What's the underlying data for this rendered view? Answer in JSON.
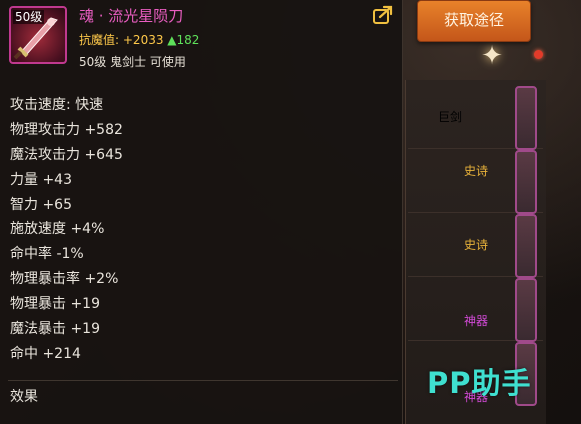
{
  "item": {
    "level_badge": "50级",
    "name": "魂 · 流光星陨刀",
    "resist_label": "抗魔值:",
    "resist_value": "+2033",
    "resist_diff": "▲182",
    "requirement": "50级 鬼剑士 可使用",
    "icon": "sword-icon",
    "name_color": "#e85dc0"
  },
  "stats": [
    "攻击速度: 快速",
    "物理攻击力 +582",
    "魔法攻击力 +645",
    "力量 +43",
    "智力 +65",
    "施放速度 +4%",
    "命中率 -1%",
    "物理暴击率 +2%",
    "物理暴击 +19",
    "魔法暴击 +19",
    "命中 +214"
  ],
  "effect_label": "效果",
  "get_button": {
    "label": "获取途径"
  },
  "share_icon": "share-icon",
  "right_panel": {
    "rows": [
      {
        "label": "巨剑",
        "color": "#b9a98a"
      },
      {
        "label": "史诗",
        "color": "#e8b23a"
      },
      {
        "label": "史诗",
        "color": "#e8b23a"
      },
      {
        "label": "神器",
        "color": "#d24ad6"
      },
      {
        "label": "神器",
        "color": "#d24ad6"
      }
    ]
  },
  "watermark": "PP助手"
}
